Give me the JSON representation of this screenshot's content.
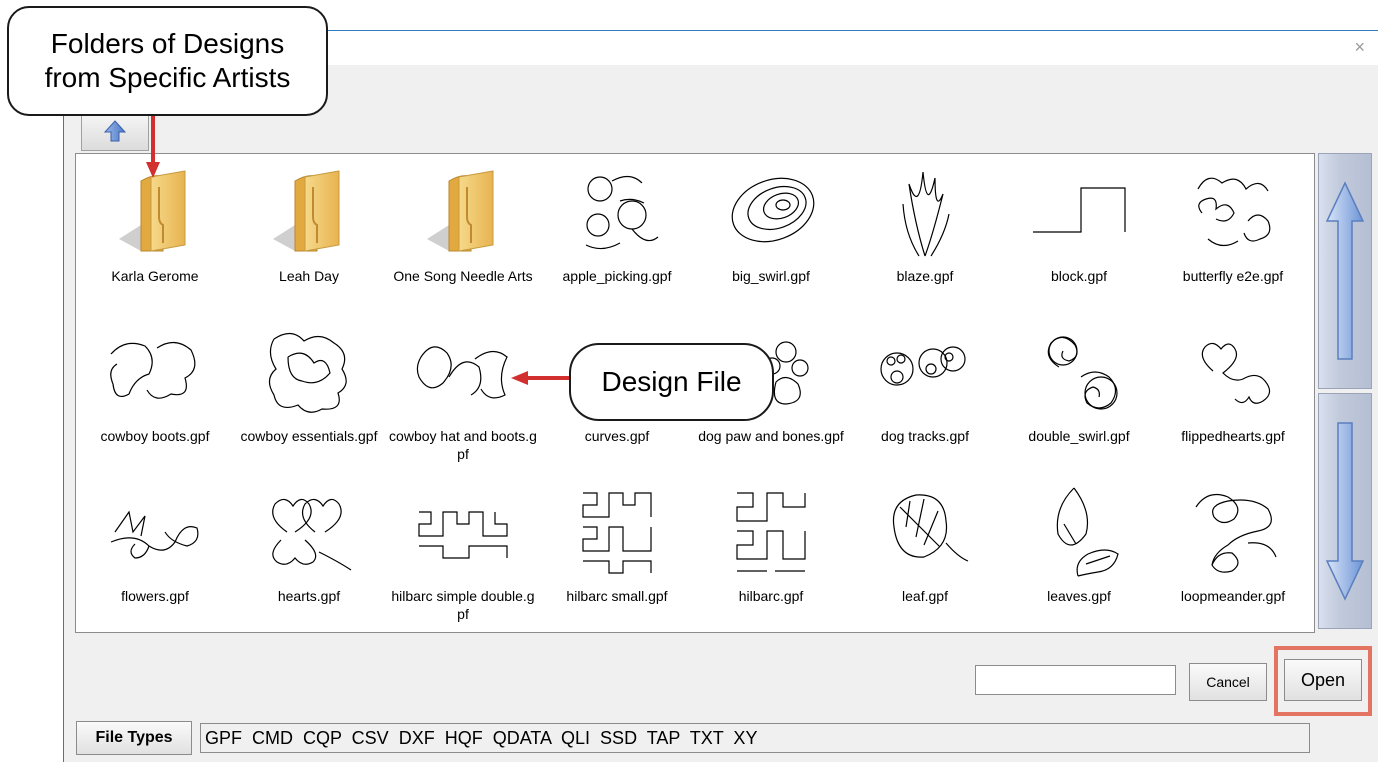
{
  "window": {
    "close_glyph": "×"
  },
  "items": [
    {
      "label": "Karla Gerome",
      "icon": "folder-icon"
    },
    {
      "label": "Leah Day",
      "icon": "folder-icon"
    },
    {
      "label": "One Song Needle Arts",
      "icon": "folder-icon"
    },
    {
      "label": "apple_picking.gpf",
      "icon": "apple-design-icon"
    },
    {
      "label": "big_swirl.gpf",
      "icon": "swirl-design-icon"
    },
    {
      "label": "blaze.gpf",
      "icon": "blaze-design-icon"
    },
    {
      "label": "block.gpf",
      "icon": "block-design-icon"
    },
    {
      "label": "butterfly e2e.gpf",
      "icon": "butterfly-design-icon"
    },
    {
      "label": "cowboy boots.gpf",
      "icon": "boots-design-icon"
    },
    {
      "label": "cowboy essentials.gpf",
      "icon": "cowboy-essentials-design-icon"
    },
    {
      "label": "cowboy hat and boots.gpf",
      "icon": "hat-boots-design-icon"
    },
    {
      "label": "curves.gpf",
      "icon": "curves-design-icon"
    },
    {
      "label": "dog paw and bones.gpf",
      "icon": "paw-bones-design-icon"
    },
    {
      "label": "dog tracks.gpf",
      "icon": "dog-tracks-design-icon"
    },
    {
      "label": "double_swirl.gpf",
      "icon": "double-swirl-design-icon"
    },
    {
      "label": "flippedhearts.gpf",
      "icon": "flipped-hearts-design-icon"
    },
    {
      "label": "flowers.gpf",
      "icon": "flowers-design-icon"
    },
    {
      "label": "hearts.gpf",
      "icon": "hearts-design-icon"
    },
    {
      "label": "hilbarc simple double.gpf",
      "icon": "hilbarc-double-design-icon"
    },
    {
      "label": "hilbarc small.gpf",
      "icon": "hilbarc-small-design-icon"
    },
    {
      "label": "hilbarc.gpf",
      "icon": "hilbarc-design-icon"
    },
    {
      "label": "leaf.gpf",
      "icon": "leaf-design-icon"
    },
    {
      "label": "leaves.gpf",
      "icon": "leaves-design-icon"
    },
    {
      "label": "loopmeander.gpf",
      "icon": "loop-meander-design-icon"
    }
  ],
  "filename_input": {
    "value": ""
  },
  "buttons": {
    "cancel": "Cancel",
    "open": "Open",
    "file_types": "File Types"
  },
  "file_types_list": "GPF  CMD  CQP  CSV  DXF  HQF  QDATA  QLI  SSD  TAP  TXT  XY",
  "annotations": {
    "callout_folders_line1": "Folders of Designs",
    "callout_folders_line2": "from Specific Artists",
    "callout_design": "Design File",
    "arrow_color": "#d22f2f",
    "highlight_color": "#e27461"
  }
}
